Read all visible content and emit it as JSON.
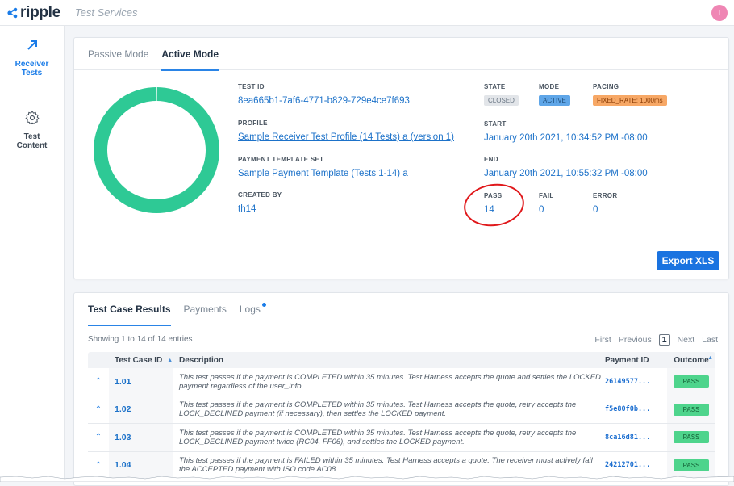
{
  "header": {
    "logo_text": "ripple",
    "app_name": "Test Services",
    "avatar_initial": "T",
    "avatar_color": "#ef86b4"
  },
  "sidebar": {
    "items": [
      {
        "label_line1": "Receiver",
        "label_line2": "Tests",
        "icon": "arrow-up-right-icon",
        "active": true
      },
      {
        "label_line1": "Test",
        "label_line2": "Content",
        "icon": "gear-icon",
        "active": false
      }
    ]
  },
  "summary": {
    "tabs": [
      {
        "label": "Passive Mode",
        "active": false
      },
      {
        "label": "Active Mode",
        "active": true
      }
    ],
    "test_id_label": "TEST ID",
    "test_id": "8ea665b1-7af6-4771-b829-729e4ce7f693",
    "profile_label": "PROFILE",
    "profile": "Sample Receiver Test Profile (14 Tests) a (version 1)",
    "template_label": "PAYMENT TEMPLATE SET",
    "template": "Sample Payment Template (Tests 1-14) a",
    "created_by_label": "CREATED BY",
    "created_by": "th14",
    "state_label": "STATE",
    "state": "CLOSED",
    "mode_label": "MODE",
    "mode": "ACTIVE",
    "pacing_label": "PACING",
    "pacing": "FIXED_RATE: 1000ms",
    "start_label": "START",
    "start": "January 20th 2021, 10:34:52 PM -08:00",
    "end_label": "END",
    "end": "January 20th 2021, 10:55:32 PM -08:00",
    "pass_label": "PASS",
    "pass": "14",
    "fail_label": "FAIL",
    "fail": "0",
    "error_label": "ERROR",
    "error": "0",
    "export_label": "Export XLS",
    "donut": {
      "pass": 14,
      "fail": 0,
      "error": 0,
      "pass_color": "#2ec995"
    }
  },
  "results": {
    "tabs": [
      {
        "label": "Test Case Results",
        "active": true
      },
      {
        "label": "Payments",
        "active": false
      },
      {
        "label": "Logs",
        "active": false,
        "has_dot": true
      }
    ],
    "showing": "Showing 1 to 14 of 14 entries",
    "pager": {
      "first": "First",
      "previous": "Previous",
      "current": "1",
      "next": "Next",
      "last": "Last"
    },
    "columns": {
      "id": "Test Case ID",
      "description": "Description",
      "payment": "Payment ID",
      "outcome": "Outcome"
    },
    "rows": [
      {
        "id": "1.01",
        "description": "This test passes if the payment is COMPLETED within 35 minutes. Test Harness accepts the quote and settles the LOCKED payment regardless of the user_info.",
        "payment": "26149577...",
        "outcome": "PASS"
      },
      {
        "id": "1.02",
        "description": "This test passes if the payment is COMPLETED within 35 minutes. Test Harness accepts the quote, retry accepts the LOCK_DECLINED payment (if necessary), then settles the LOCKED payment.",
        "payment": "f5e80f0b...",
        "outcome": "PASS"
      },
      {
        "id": "1.03",
        "description": "This test passes if the payment is COMPLETED within 35 minutes. Test Harness accepts the quote, retry accepts the LOCK_DECLINED payment twice (RC04, FF06), and settles the LOCKED payment.",
        "payment": "8ca16d81...",
        "outcome": "PASS"
      },
      {
        "id": "1.04",
        "description": "This test passes if the payment is FAILED within 35 minutes. Test Harness accepts a quote. The receiver must actively fail the ACCEPTED payment with ISO code AC08.",
        "payment": "24212701...",
        "outcome": "PASS"
      }
    ]
  }
}
